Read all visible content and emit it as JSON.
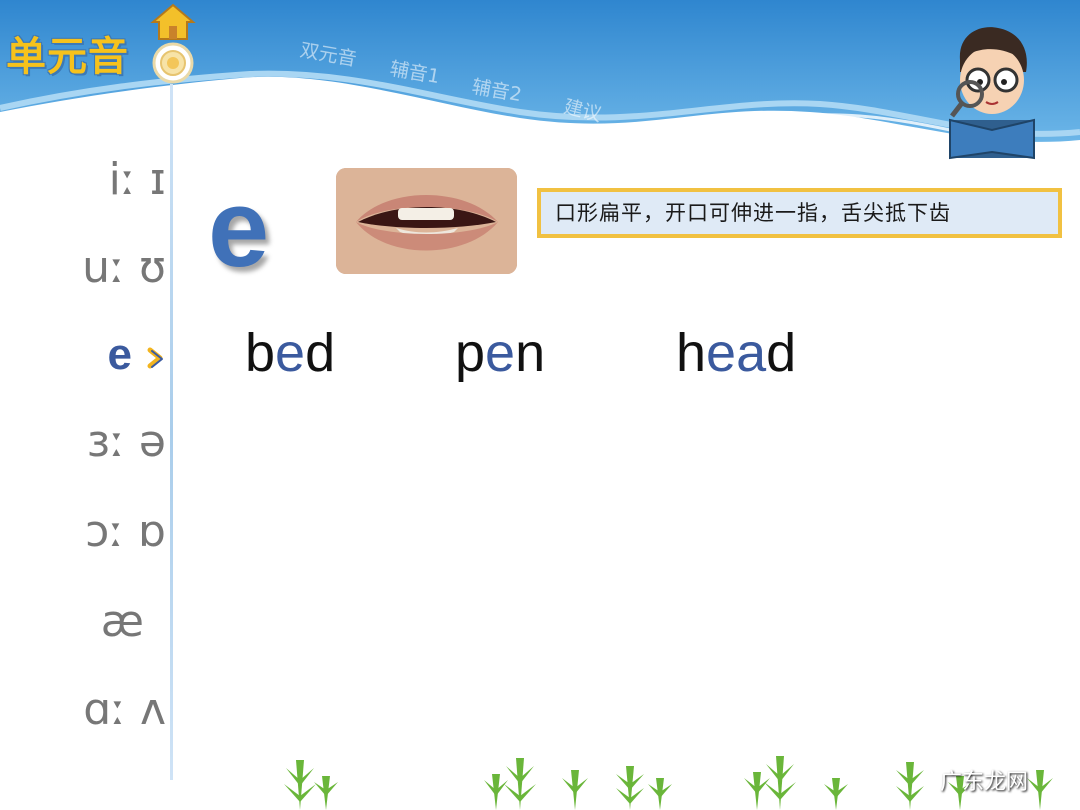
{
  "header": {
    "category_title": "单元音",
    "nav_tabs": [
      "双元音",
      "辅音1",
      "辅音2",
      "建议"
    ]
  },
  "sidebar": {
    "phonemes": [
      "iː  ɪ",
      "uː  ʊ",
      "e",
      "ɜː  ə",
      "ɔː  ɒ",
      "æ",
      "ɑː  ʌ"
    ],
    "selected_index": 2
  },
  "main": {
    "big_phoneme": "e",
    "mouth_tip": "口形扁平，开口可伸进一指，舌尖抵下齿",
    "words": [
      {
        "pre": "b",
        "hl": "e",
        "post": "d"
      },
      {
        "pre": "p",
        "hl": "e",
        "post": "n"
      },
      {
        "pre": "h",
        "hl": "ea",
        "post": "d"
      }
    ]
  },
  "footer": {
    "watermark": "广东龙网"
  },
  "colors": {
    "accent_blue": "#3b5a9e",
    "title_yellow": "#f6c21c",
    "tip_border": "#f1c141",
    "sky_blue": "#3d93d6"
  }
}
